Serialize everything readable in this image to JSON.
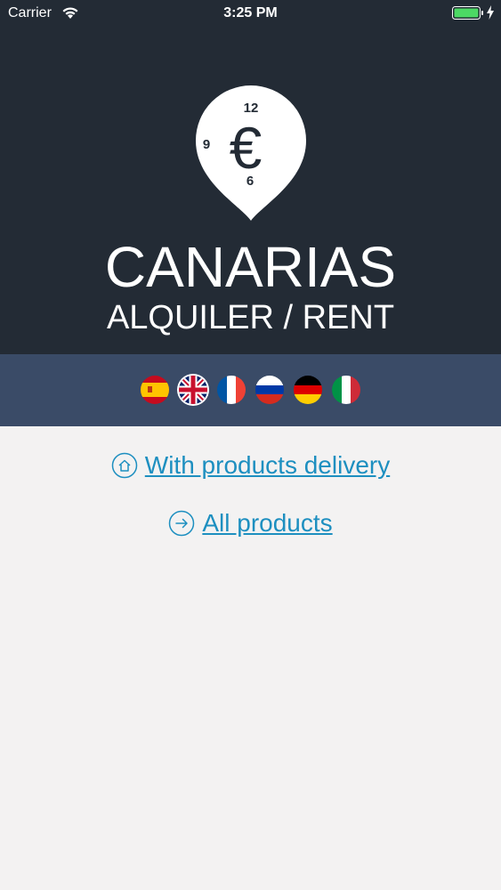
{
  "status_bar": {
    "carrier": "Carrier",
    "time": "3:25 PM"
  },
  "logo": {
    "top_number": "12",
    "left_number": "9",
    "bottom_number": "6",
    "symbol": "€"
  },
  "brand": {
    "title": "CANARIAS",
    "subtitle": "ALQUILER / RENT"
  },
  "languages": {
    "flags": [
      "spain-flag",
      "uk-flag",
      "france-flag",
      "russia-flag",
      "germany-flag",
      "italy-flag"
    ],
    "selected": "uk-flag"
  },
  "links": {
    "delivery": "With products delivery",
    "all_products": "All products"
  },
  "colors": {
    "header_bg": "#232b35",
    "language_bar_bg": "#3a4b67",
    "link": "#1d8fc0",
    "page_bg": "#f3f2f2"
  }
}
